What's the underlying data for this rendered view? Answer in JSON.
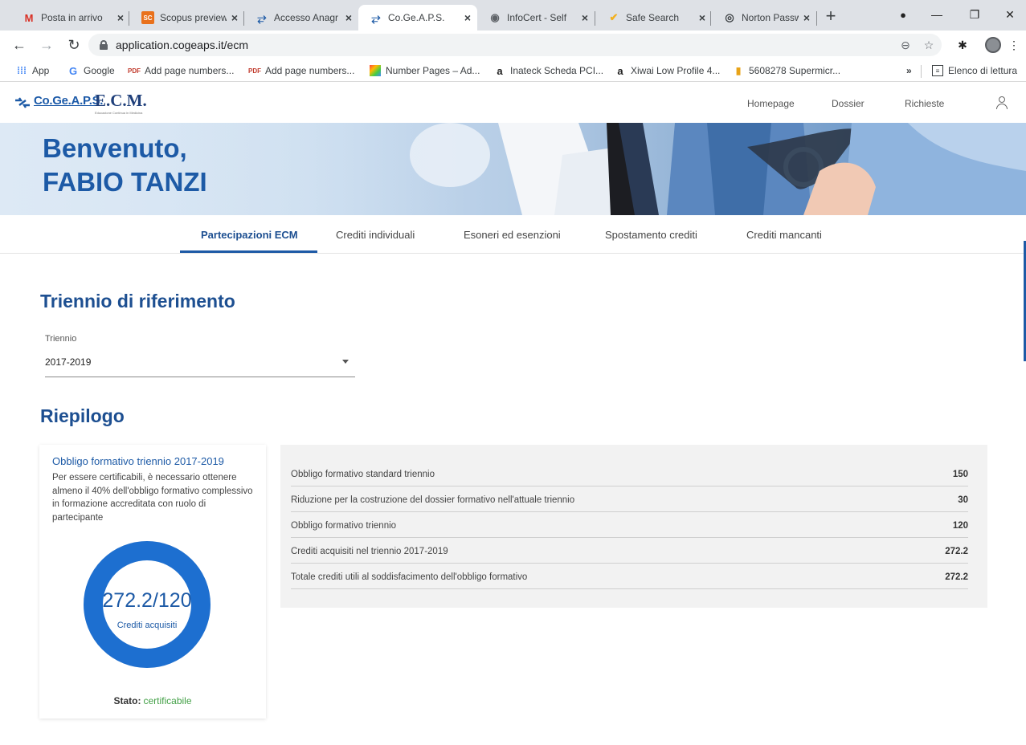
{
  "browser": {
    "tabs": [
      {
        "title": "Posta in arrivo",
        "favicon": "gmail-icon"
      },
      {
        "title": "Scopus preview",
        "favicon": "scopus-icon"
      },
      {
        "title": "Accesso Anagr",
        "favicon": "cogeaps-icon"
      },
      {
        "title": "Co.Ge.A.P.S.",
        "favicon": "cogeaps-icon",
        "active": true
      },
      {
        "title": "InfoCert - Self",
        "favicon": "globe-icon"
      },
      {
        "title": "Safe Search",
        "favicon": "check-icon"
      },
      {
        "title": "Norton Passwo",
        "favicon": "norton-icon"
      }
    ],
    "url": "application.cogeaps.it/ecm",
    "bookmarks": [
      {
        "label": "App"
      },
      {
        "label": "Google"
      },
      {
        "label": "Add page numbers..."
      },
      {
        "label": "Add page numbers..."
      },
      {
        "label": "Number Pages – Ad..."
      },
      {
        "label": "Inateck Scheda PCI..."
      },
      {
        "label": "Xiwai Low Profile 4..."
      },
      {
        "label": "5608278 Supermicr..."
      }
    ],
    "bookmarks_more": "»",
    "reading_list": "Elenco di lettura"
  },
  "site": {
    "logo": "Co.Ge.A.P.S.",
    "ecm_logo": "E.C.M.",
    "ecm_subtitle": "Educazione Continua in Medicina",
    "nav": [
      "Homepage",
      "Dossier",
      "Richieste"
    ]
  },
  "hero": {
    "line1": "Benvenuto,",
    "line2": "FABIO TANZI"
  },
  "subnav": [
    {
      "label": "Partecipazioni ECM",
      "active": true
    },
    {
      "label": "Crediti individuali"
    },
    {
      "label": "Esoneri ed esenzioni"
    },
    {
      "label": "Spostamento crediti"
    },
    {
      "label": "Crediti mancanti"
    }
  ],
  "triennio": {
    "heading": "Triennio di riferimento",
    "field_label": "Triennio",
    "selected": "2017-2019"
  },
  "riepilogo": {
    "heading": "Riepilogo",
    "card": {
      "title": "Obbligo formativo triennio 2017-2019",
      "text": "Per essere certificabili, è necessario ottenere almeno il 40% dell'obbligo formativo complessivo in formazione accreditata con ruolo di partecipante",
      "donut_value": "272.2/120",
      "donut_label": "Crediti acquisiti",
      "progress_fraction": 1.0,
      "status_key": "Stato:",
      "status_value": "certificabile"
    },
    "rows": [
      {
        "label": "Obbligo formativo standard triennio",
        "value": "150"
      },
      {
        "label": "Riduzione per la costruzione del dossier formativo nell'attuale triennio",
        "value": "30"
      },
      {
        "label": "Obbligo formativo triennio",
        "value": "120"
      },
      {
        "label": "Crediti acquisiti nel triennio 2017-2019",
        "value": "272.2"
      },
      {
        "label": "Totale crediti utili al soddisfacimento dell'obbligo formativo",
        "value": "272.2"
      }
    ]
  },
  "colors": {
    "brand_blue": "#1d5aa6",
    "status_green": "#43a047"
  }
}
